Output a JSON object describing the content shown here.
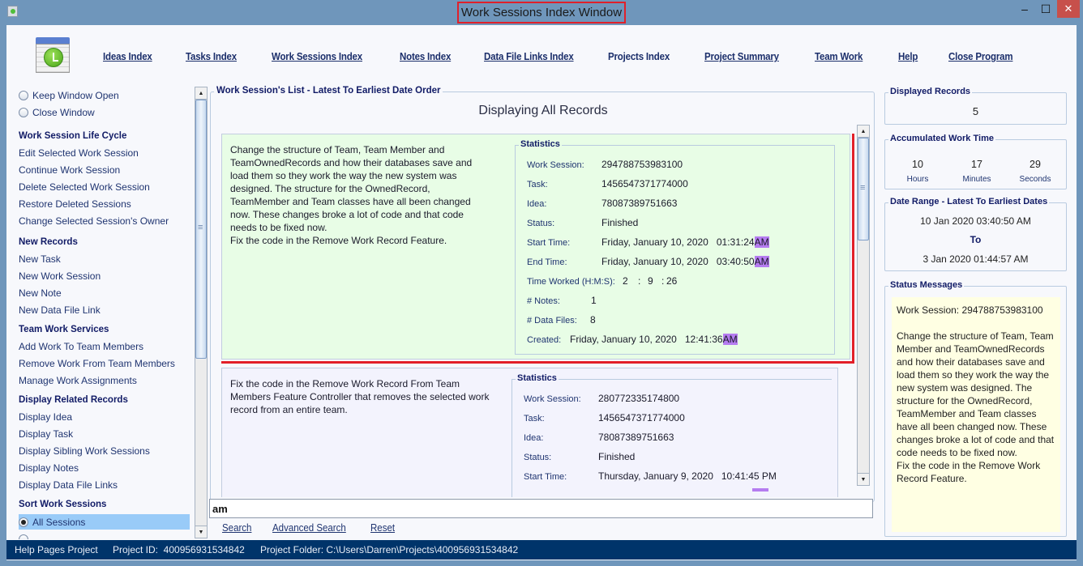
{
  "window": {
    "title": "Work Sessions Index Window",
    "minimize_label": "‒",
    "maximize_label": "☐",
    "close_label": "✕"
  },
  "toolbar": {
    "logo": "calendar-clock-icon",
    "links": [
      {
        "label": "Ideas Index",
        "mnemonic": "I"
      },
      {
        "label": "Tasks Index",
        "mnemonic": "T"
      },
      {
        "label": "Work Sessions Index",
        "mnemonic": "W"
      },
      {
        "label": "Notes Index",
        "mnemonic": "N"
      },
      {
        "label": "Data File Links Index",
        "mnemonic": "D"
      },
      {
        "label": "Projects Index",
        "mnemonic": ""
      },
      {
        "label": "Project Summary",
        "mnemonic": "P"
      },
      {
        "label": "Team Work",
        "mnemonic": "e"
      },
      {
        "label": "Help",
        "mnemonic": "H"
      },
      {
        "label": "Close Program",
        "mnemonic": "C"
      }
    ]
  },
  "sidebar": {
    "window_options": [
      {
        "label": "Keep Window Open",
        "checked": false
      },
      {
        "label": "Close Window",
        "checked": false
      }
    ],
    "sections": [
      {
        "header": "Work Session Life Cycle",
        "items": [
          "Edit Selected Work Session",
          "Continue Work Session",
          "Delete Selected Work Session",
          "Restore Deleted Sessions",
          "Change Selected Session's Owner"
        ]
      },
      {
        "header": "New Records",
        "items": [
          "New Task",
          "New Work Session",
          "New Note",
          "New Data File Link"
        ]
      },
      {
        "header": "Team Work Services",
        "items": [
          "Add Work To Team Members",
          "Remove Work From Team Members",
          "Manage Work Assignments"
        ]
      },
      {
        "header": "Display Related Records",
        "items": [
          "Display Idea",
          "Display Task",
          "Display Sibling Work Sessions",
          "Display Notes",
          "Display Data File Links"
        ]
      }
    ],
    "sort_header": "Sort Work Sessions",
    "sort_options": [
      {
        "label": "All Sessions",
        "checked": true
      }
    ]
  },
  "main": {
    "frame_title": "Work Session's List - Latest To Earliest Date Order",
    "display_title": "Displaying All Records",
    "stats_title": "Statistics",
    "labels": {
      "work_session": "Work Session:",
      "task": "Task:",
      "idea": "Idea:",
      "status": "Status:",
      "start_time": "Start Time:",
      "end_time": "End Time:",
      "time_worked": "Time Worked (H:M:S):",
      "notes": "# Notes:",
      "data_files": "# Data Files:",
      "created": "Created:"
    },
    "records": [
      {
        "selected": true,
        "description": "Change the structure of Team, Team Member and TeamOwnedRecords and how their databases save and load them so they work the way the new system was designed. The structure for the OwnedRecord, TeamMember and Team classes have all been changed now. These changes broke a lot of code and that code needs to be fixed now.\nFix the code in the Remove Work Record Feature.",
        "work_session": "294788753983100",
        "task": "1456547371774000",
        "idea": "78087389751663",
        "status": "Finished",
        "start_time": "Friday, January 10, 2020   01:31:24",
        "start_ampm": "AM",
        "end_time": "Friday, January 10, 2020   03:40:50",
        "end_ampm": "AM",
        "hours": "2",
        "minutes": "9",
        "seconds": "26",
        "notes": "1",
        "data_files": "8",
        "created": "Friday, January 10, 2020   12:41:36",
        "created_ampm": "AM"
      },
      {
        "selected": false,
        "description": "Fix the code in the Remove Work Record From Team Members Feature Controller that removes the selected work record from an entire team.",
        "work_session": "280772335174800",
        "task": "1456547371774000",
        "idea": "78087389751663",
        "status": "Finished",
        "start_time": "Thursday, January 9, 2020   10:41:45 PM"
      }
    ]
  },
  "search": {
    "value": "am",
    "buttons": [
      {
        "label": "Search",
        "mnemonic": "S"
      },
      {
        "label": "Advanced Search",
        "mnemonic": "A"
      },
      {
        "label": "Reset",
        "mnemonic": "R"
      }
    ]
  },
  "right_panel": {
    "displayed_records": {
      "title": "Displayed Records",
      "value": "5"
    },
    "accumulated": {
      "title": "Accumulated Work Time",
      "hours": "10",
      "hours_label": "Hours",
      "minutes": "17",
      "minutes_label": "Minutes",
      "seconds": "29",
      "seconds_label": "Seconds"
    },
    "date_range": {
      "title": "Date Range - Latest To Earliest Dates",
      "latest": "10 Jan 2020  03:40:50 AM",
      "to": "To",
      "earliest": "3 Jan 2020  01:44:57 AM"
    },
    "status_messages": {
      "title": "Status Messages",
      "text": "Work Session: 294788753983100\n\nChange the structure of Team, Team Member and TeamOwnedRecords and how their databases save and load them so they work the way the new system was designed. The structure for the OwnedRecord, TeamMember and Team classes have all been changed now. These changes broke a lot of code and that code needs to be fixed now.\nFix the code in the Remove Work Record Feature."
    }
  },
  "statusbar": {
    "project_name": "Help Pages Project",
    "project_id": "Project ID:  400956931534842",
    "project_folder": "Project Folder: C:\\Users\\Darren\\Projects\\400956931534842"
  },
  "colors": {
    "accent": "#1c2f6b",
    "section_header": "#111b66",
    "selected_highlight": "#e21f28",
    "record_selected_bg": "#e8fde6",
    "record_bg": "#f3f3fd",
    "search_hit": "#b57cf0",
    "statusbar_bg": "#00346a",
    "status_message_bg": "#ffffe3",
    "sort_selected_bg": "#99cbf8"
  }
}
